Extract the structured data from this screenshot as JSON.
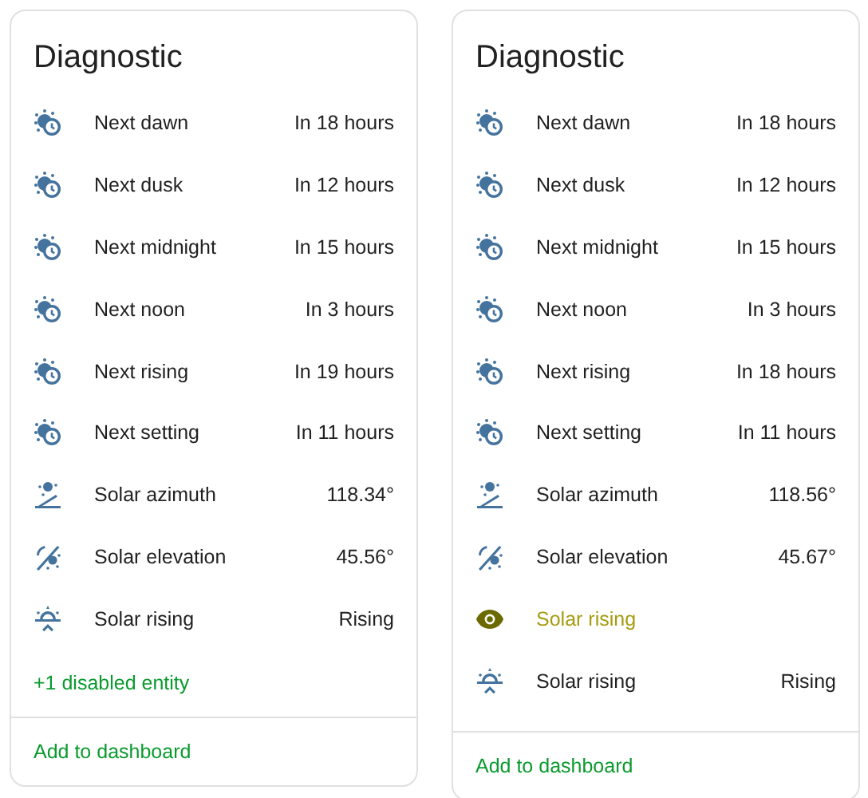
{
  "cards": [
    {
      "title": "Diagnostic",
      "rows": [
        {
          "kind": "time",
          "name": "Next dawn",
          "value": "In 18 hours"
        },
        {
          "kind": "time",
          "name": "Next dusk",
          "value": "In 12 hours"
        },
        {
          "kind": "time",
          "name": "Next midnight",
          "value": "In 15 hours"
        },
        {
          "kind": "time",
          "name": "Next noon",
          "value": "In 3 hours"
        },
        {
          "kind": "time",
          "name": "Next rising",
          "value": "In 19 hours"
        },
        {
          "kind": "time",
          "name": "Next setting",
          "value": "In 11 hours"
        },
        {
          "kind": "azimuth",
          "name": "Solar azimuth",
          "value": "118.34°"
        },
        {
          "kind": "elevation",
          "name": "Solar elevation",
          "value": "45.56°"
        },
        {
          "kind": "rising",
          "name": "Solar rising",
          "value": "Rising"
        }
      ],
      "disabled_link": "+1 disabled entity",
      "action": "Add to dashboard"
    },
    {
      "title": "Diagnostic",
      "rows": [
        {
          "kind": "time",
          "name": "Next dawn",
          "value": "In 18 hours"
        },
        {
          "kind": "time",
          "name": "Next dusk",
          "value": "In 12 hours"
        },
        {
          "kind": "time",
          "name": "Next midnight",
          "value": "In 15 hours"
        },
        {
          "kind": "time",
          "name": "Next noon",
          "value": "In 3 hours"
        },
        {
          "kind": "time",
          "name": "Next rising",
          "value": "In 18 hours"
        },
        {
          "kind": "time",
          "name": "Next setting",
          "value": "In 11 hours"
        },
        {
          "kind": "azimuth",
          "name": "Solar azimuth",
          "value": "118.56°"
        },
        {
          "kind": "elevation",
          "name": "Solar elevation",
          "value": "45.67°"
        },
        {
          "kind": "hidden",
          "name": "Solar rising"
        },
        {
          "kind": "rising",
          "name": "Solar rising",
          "value": "Rising"
        }
      ],
      "action": "Add to dashboard"
    }
  ]
}
